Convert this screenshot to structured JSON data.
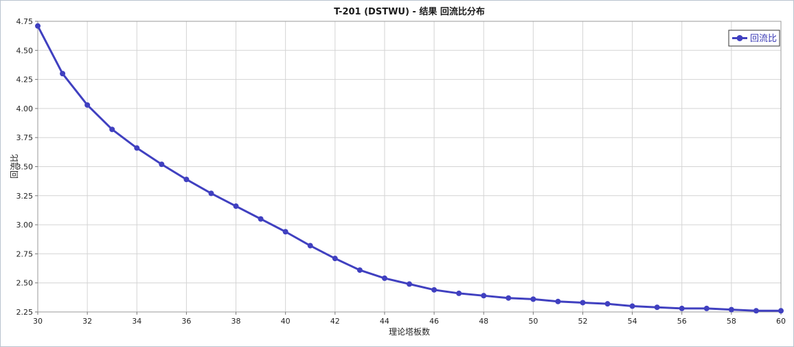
{
  "chart_data": {
    "type": "line",
    "title": "T-201 (DSTWU) - 结果 回流比分布",
    "xlabel": "理论塔板数",
    "ylabel": "回流比",
    "xlim": [
      30,
      60
    ],
    "ylim": [
      2.25,
      4.75
    ],
    "xticks": [
      "30",
      "32",
      "34",
      "36",
      "38",
      "40",
      "42",
      "44",
      "46",
      "48",
      "50",
      "52",
      "54",
      "56",
      "58",
      "60"
    ],
    "yticks": [
      "2.25",
      "2.50",
      "2.75",
      "3.00",
      "3.25",
      "3.50",
      "3.75",
      "4.00",
      "4.25",
      "4.50",
      "4.75"
    ],
    "grid": true,
    "legend_position": "top-right",
    "series": [
      {
        "name": "回流比",
        "color": "#4040c0",
        "x": [
          30,
          31,
          32,
          33,
          34,
          35,
          36,
          37,
          38,
          39,
          40,
          41,
          42,
          43,
          44,
          45,
          46,
          47,
          48,
          49,
          50,
          51,
          52,
          53,
          54,
          55,
          56,
          57,
          58,
          59,
          60
        ],
        "values": [
          4.71,
          4.3,
          4.03,
          3.82,
          3.66,
          3.52,
          3.39,
          3.27,
          3.16,
          3.05,
          2.94,
          2.82,
          2.71,
          2.61,
          2.54,
          2.49,
          2.44,
          2.41,
          2.39,
          2.37,
          2.36,
          2.34,
          2.33,
          2.32,
          2.3,
          2.29,
          2.28,
          2.28,
          2.27,
          2.26,
          2.26
        ]
      }
    ]
  }
}
